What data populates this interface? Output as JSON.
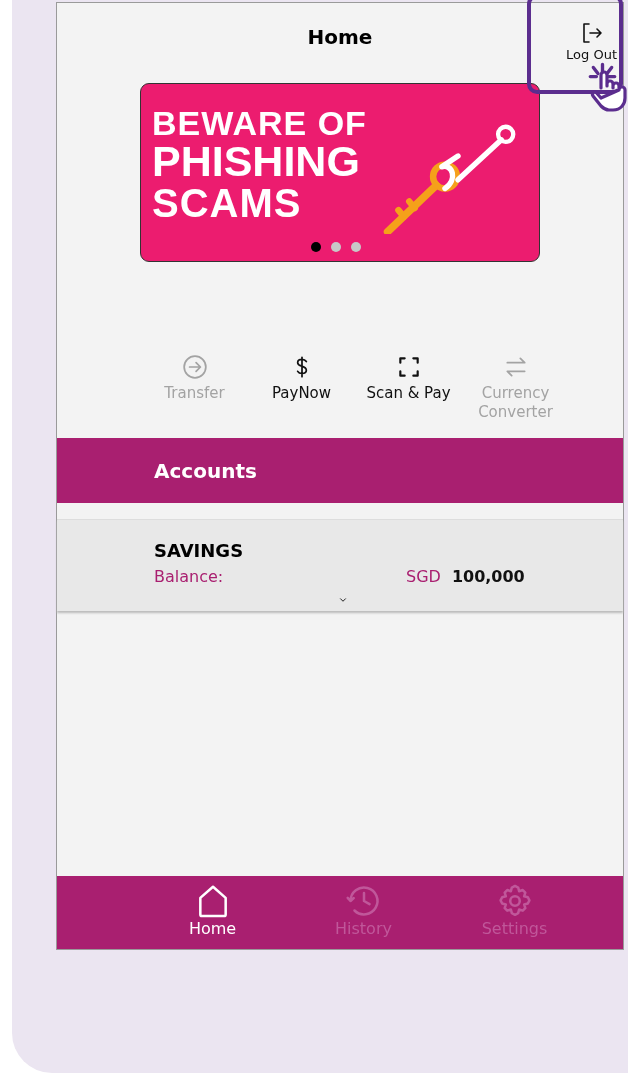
{
  "header": {
    "title": "Home",
    "logout": {
      "label": "Log Out",
      "highlighted": true
    }
  },
  "banner": {
    "lines": [
      "BEWARE OF",
      "PHISHING",
      "SCAMS"
    ],
    "dots": [
      {
        "selected": true
      },
      {
        "selected": false
      },
      {
        "selected": false
      }
    ]
  },
  "actions": [
    {
      "kind": "transfer",
      "label": "Transfer",
      "disabled": true
    },
    {
      "kind": "paynow",
      "label": "PayNow",
      "disabled": false
    },
    {
      "kind": "scan",
      "label": "Scan & Pay",
      "disabled": false
    },
    {
      "kind": "currency",
      "label": "Currency Converter",
      "disabled": true
    }
  ],
  "accounts": {
    "title": "Accounts",
    "items": [
      {
        "name": "SAVINGS",
        "balance_label": "Balance:",
        "currency": "SGD",
        "amount": "100,000"
      }
    ]
  },
  "nav": [
    {
      "kind": "home",
      "label": "Home",
      "selected": true
    },
    {
      "kind": "history",
      "label": "History",
      "selected": false
    },
    {
      "kind": "settings",
      "label": "Settings",
      "selected": false
    }
  ]
}
